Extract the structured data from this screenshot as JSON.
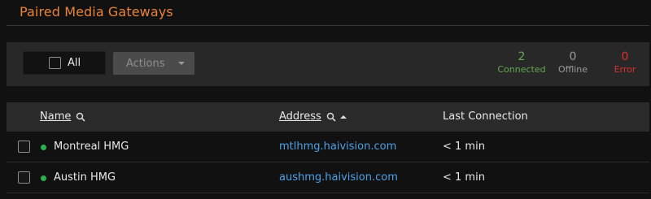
{
  "page": {
    "title": "Paired Media Gateways"
  },
  "toolbar": {
    "select_all_label": "All",
    "actions_label": "Actions",
    "stats": [
      {
        "value": "2",
        "label": "Connected",
        "color": "#64a852"
      },
      {
        "value": "0",
        "label": "Offline",
        "color": "#9b9b9b"
      },
      {
        "value": "0",
        "label": "Error",
        "color": "#e0302f"
      }
    ]
  },
  "table": {
    "columns": [
      {
        "label": "Name",
        "icon": "search-icon"
      },
      {
        "label": "Address",
        "icon": "search-icon",
        "sort": "ascending"
      },
      {
        "label": "Last Connection"
      }
    ],
    "rows": [
      {
        "status": "connected",
        "name": "Montreal HMG",
        "address": "mtlhmg.haivision.com",
        "last_connection": "< 1 min"
      },
      {
        "status": "connected",
        "name": "Austin HMG",
        "address": "aushmg.haivision.com",
        "last_connection": "< 1 min"
      }
    ]
  },
  "colors": {
    "accent": "#e8833a",
    "link": "#4ea1e6",
    "status_dot": "#2bb24c"
  }
}
